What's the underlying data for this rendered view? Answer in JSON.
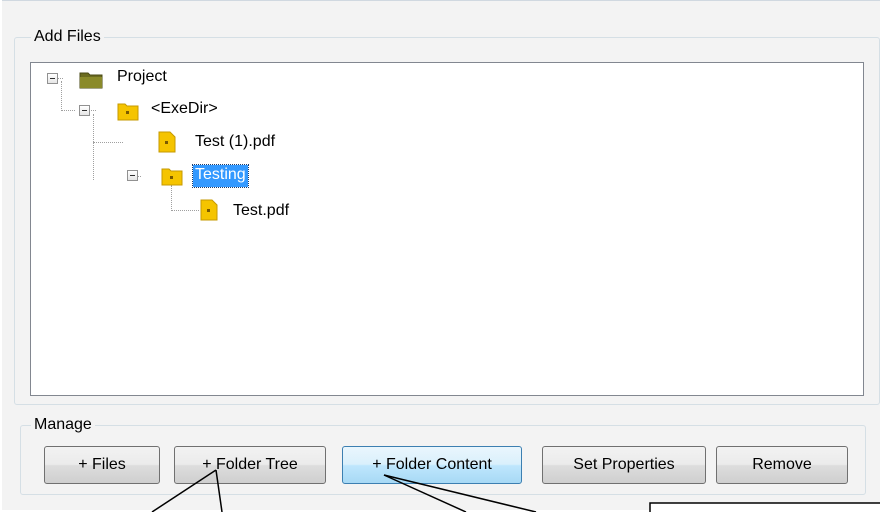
{
  "add_files": {
    "legend": "Add Files",
    "tree": {
      "root": "Project",
      "exedir": "<ExeDir>",
      "file1": "Test (1).pdf",
      "folder": "Testing",
      "file2": "Test.pdf"
    }
  },
  "manage": {
    "legend": "Manage",
    "buttons": {
      "files": "+ Files",
      "folder_tree": "+ Folder Tree",
      "folder_content": "+ Folder Content",
      "set_properties": "Set Properties",
      "remove": "Remove"
    }
  },
  "colors": {
    "selection": "#3399ff",
    "folder": "#f5c400",
    "project_folder": "#6b6b1f"
  },
  "selected_node": "Testing"
}
